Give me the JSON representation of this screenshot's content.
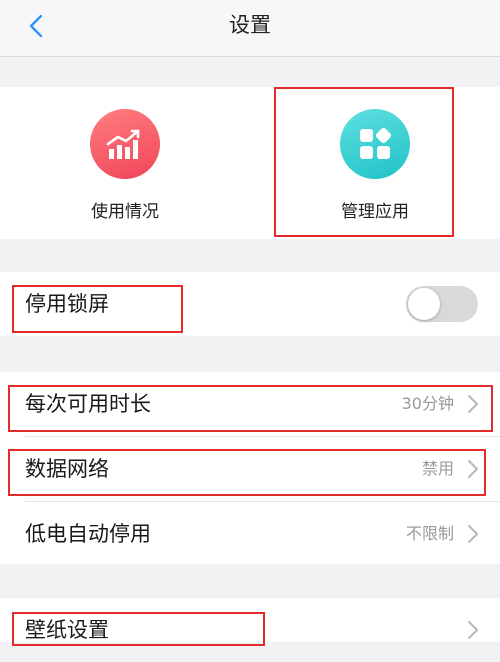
{
  "header": {
    "title": "设置",
    "back_icon": "chevron-left-icon"
  },
  "quick_actions": [
    {
      "label": "使用情况",
      "icon": "chart-icon",
      "color": "#f0445a"
    },
    {
      "label": "管理应用",
      "icon": "apps-grid-icon",
      "color": "#1fc2c8"
    }
  ],
  "settings": {
    "disable_lock_screen": {
      "label": "停用锁屏",
      "toggle_on": false
    },
    "usage_limit": {
      "label": "每次可用时长",
      "value": "30分钟"
    },
    "mobile_data": {
      "label": "数据网络",
      "value": "禁用"
    },
    "low_battery": {
      "label": "低电自动停用",
      "value": "不限制"
    },
    "wallpaper": {
      "label": "壁纸设置"
    }
  },
  "colors": {
    "accent": "#2b95ff",
    "highlight_border": "#e32b2b",
    "background": "#f2f2f4"
  }
}
